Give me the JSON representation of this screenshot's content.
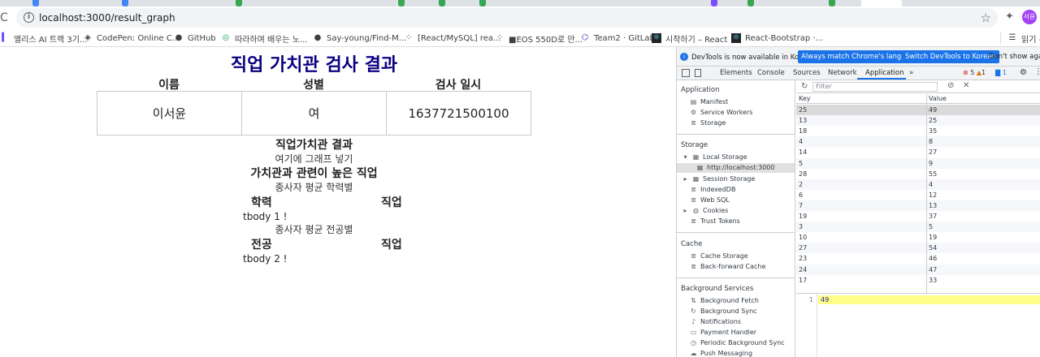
{
  "browser": {
    "url": "localhost:3000/result_graph",
    "profile_initials": "서윤",
    "bookmarks": [
      {
        "label": "엘리스 AI 트랙 3기...",
        "icon": "elice-icon"
      },
      {
        "label": "CodePen: Online C...",
        "icon": "codepen-icon"
      },
      {
        "label": "GitHub",
        "icon": "github-icon"
      },
      {
        "label": "따라하며 배우는 노...",
        "icon": "bookmark-icon"
      },
      {
        "label": "Say-young/Find-M...",
        "icon": "github-icon"
      },
      {
        "label": "[React/MySQL] rea...",
        "icon": "bookmark-icon"
      },
      {
        "label": "■EOS 550D로 만...",
        "icon": "bookmark-icon"
      },
      {
        "label": "Team2 · GitLab",
        "icon": "gitlab-icon"
      },
      {
        "label": "시작하기 – React",
        "icon": "react-icon"
      },
      {
        "label": "React-Bootstrap ·...",
        "icon": "bootstrap-icon"
      }
    ],
    "reading_list": "읽기 ‹"
  },
  "page": {
    "title": "직업 가치관 검사 결과",
    "info_headers": [
      "이름",
      "성별",
      "검사 일시"
    ],
    "info_values": [
      "이서윤",
      "여",
      "1637721500100"
    ],
    "section1_title": "직업가치관 결과",
    "section1_note": "여기에 그래프 넣기",
    "section2_title": "가치관과 관련이 높은 직업",
    "sub1_note": "종사자 평균 학력별",
    "sub1_col1": "학력",
    "sub1_col2": "직업",
    "tbody1": "tbody 1 !",
    "sub2_note": "종사자 평균 전공별",
    "sub2_col1": "전공",
    "sub2_col2": "직업",
    "tbody2": "tbody 2 !"
  },
  "devtools": {
    "notice": "DevTools is now available in Korean!",
    "btn_match": "Always match Chrome's language",
    "btn_switch": "Switch DevTools to Korean",
    "btn_dismiss": "Don't show again",
    "tabs": [
      "Elements",
      "Console",
      "Sources",
      "Network",
      "Application"
    ],
    "active_tab": "Application",
    "more_tabs": "»",
    "errors": "5",
    "warnings": "1",
    "issues": "1",
    "sidebar": {
      "application_header": "Application",
      "application_items": [
        "Manifest",
        "Service Workers",
        "Storage"
      ],
      "storage_header": "Storage",
      "local_storage": "Local Storage",
      "local_origin": "http://localhost:3000",
      "storage_items": [
        "Session Storage",
        "IndexedDB",
        "Web SQL",
        "Cookies",
        "Trust Tokens"
      ],
      "cache_header": "Cache",
      "cache_items": [
        "Cache Storage",
        "Back-forward Cache"
      ],
      "bg_header": "Background Services",
      "bg_items": [
        "Background Fetch",
        "Background Sync",
        "Notifications",
        "Payment Handler",
        "Periodic Background Sync",
        "Push Messaging"
      ]
    },
    "filter_placeholder": "Filter",
    "kv_headers": {
      "key": "Key",
      "value": "Value"
    },
    "rows": [
      {
        "k": "25",
        "v": "49"
      },
      {
        "k": "13",
        "v": "25"
      },
      {
        "k": "18",
        "v": "35"
      },
      {
        "k": "4",
        "v": "8"
      },
      {
        "k": "14",
        "v": "27"
      },
      {
        "k": "5",
        "v": "9"
      },
      {
        "k": "28",
        "v": "55"
      },
      {
        "k": "2",
        "v": "4"
      },
      {
        "k": "6",
        "v": "12"
      },
      {
        "k": "7",
        "v": "13"
      },
      {
        "k": "19",
        "v": "37"
      },
      {
        "k": "3",
        "v": "5"
      },
      {
        "k": "10",
        "v": "19"
      },
      {
        "k": "27",
        "v": "54"
      },
      {
        "k": "23",
        "v": "46"
      },
      {
        "k": "24",
        "v": "47"
      },
      {
        "k": "17",
        "v": "33"
      }
    ],
    "preview_line": "1",
    "preview_value": "49"
  }
}
